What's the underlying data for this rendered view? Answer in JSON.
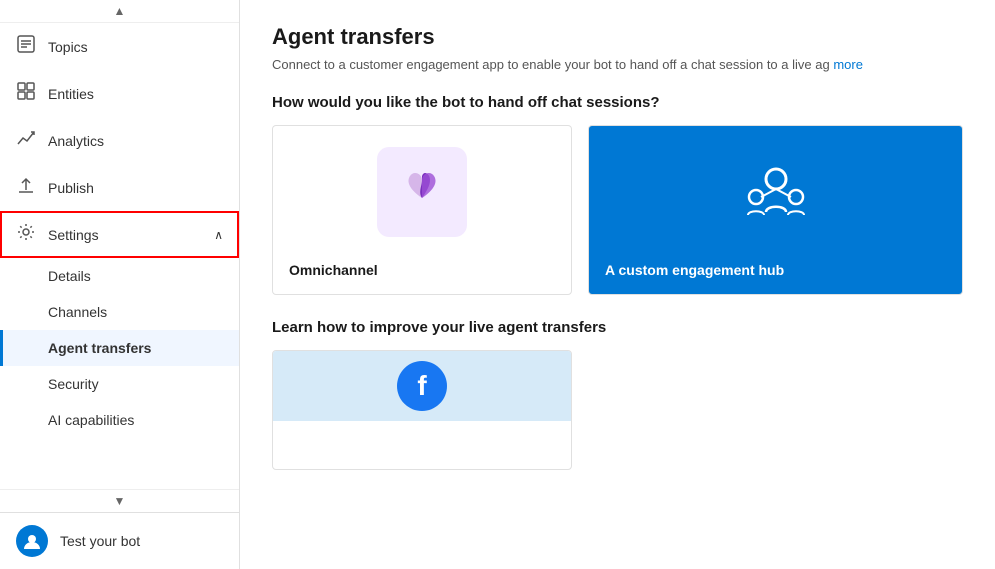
{
  "sidebar": {
    "scroll_up_arrow": "▲",
    "scroll_down_arrow": "▼",
    "items": [
      {
        "id": "topics",
        "label": "Topics",
        "icon": "💬",
        "active": false
      },
      {
        "id": "entities",
        "label": "Entities",
        "icon": "⊞",
        "active": false
      },
      {
        "id": "analytics",
        "label": "Analytics",
        "icon": "↗",
        "active": false
      },
      {
        "id": "publish",
        "label": "Publish",
        "icon": "↑",
        "active": false
      },
      {
        "id": "settings",
        "label": "Settings",
        "icon": "⚙",
        "active": true,
        "hasChevron": true,
        "chevron": "∧"
      }
    ],
    "sub_items": [
      {
        "id": "details",
        "label": "Details",
        "active": false
      },
      {
        "id": "channels",
        "label": "Channels",
        "active": false
      },
      {
        "id": "agent-transfers",
        "label": "Agent transfers",
        "active": true
      },
      {
        "id": "security",
        "label": "Security",
        "active": false
      },
      {
        "id": "ai-capabilities",
        "label": "AI capabilities",
        "active": false
      }
    ],
    "bottom": {
      "label": "Test your bot",
      "icon": "🤖"
    }
  },
  "main": {
    "title": "Agent transfers",
    "subtitle": "Connect to a customer engagement app to enable your bot to hand off a chat session to a live ag",
    "subtitle_link": "more",
    "section1_title": "How would you like the bot to hand off chat sessions?",
    "section2_title": "Learn how to improve your live agent transfers",
    "cards": [
      {
        "id": "omnichannel",
        "label": "Omnichannel",
        "type": "omnichannel"
      },
      {
        "id": "custom-hub",
        "label": "A custom engagement hub",
        "type": "custom"
      }
    ],
    "learn_cards": [
      {
        "id": "facebook",
        "type": "facebook"
      }
    ]
  }
}
